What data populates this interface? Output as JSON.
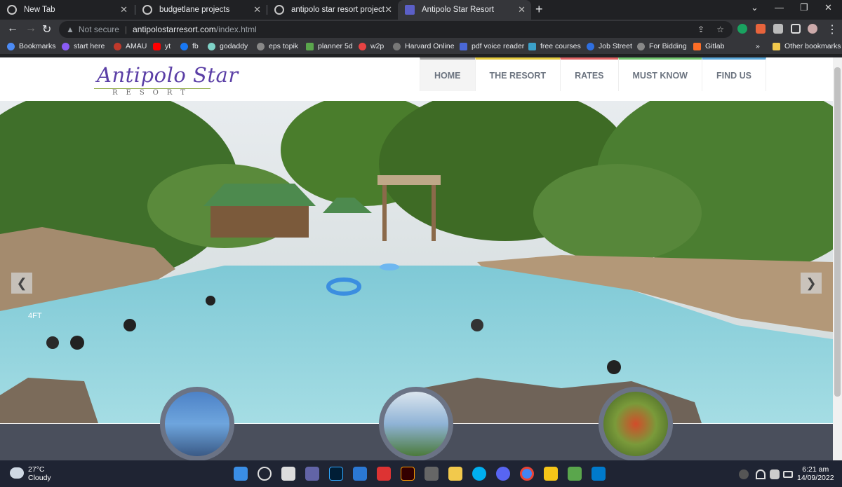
{
  "browser": {
    "tabs": [
      {
        "title": "New Tab"
      },
      {
        "title": "budgetlane projects"
      },
      {
        "title": "antipolo star resort project"
      },
      {
        "title": "Antipolo Star Resort"
      }
    ],
    "url_security": "Not secure",
    "url_host": "antipolostarresort.com",
    "url_path": "/index.html",
    "bookmarks": [
      "Bookmarks",
      "start here",
      "AMAU",
      "yt",
      "fb",
      "godaddy",
      "eps topik",
      "planner 5d",
      "w2p",
      "Harvard Online",
      "pdf voice reader",
      "free courses",
      "Job Street",
      "For Bidding",
      "Gitlab"
    ],
    "other_bookmarks": "Other bookmarks",
    "more_bookmarks": "»"
  },
  "site": {
    "logo_text": "Antipolo Star",
    "logo_sub": "RESORT",
    "menu": [
      {
        "label": "HOME",
        "color": "#9e9e9e"
      },
      {
        "label": "THE RESORT",
        "color": "#e3c93c"
      },
      {
        "label": "RATES",
        "color": "#e06363"
      },
      {
        "label": "MUST KNOW",
        "color": "#6fc36b"
      },
      {
        "label": "FIND US",
        "color": "#5aa7d8"
      }
    ],
    "slider": {
      "prev": "❮",
      "next": "❯"
    },
    "pool_marker": "4FT"
  },
  "taskbar": {
    "temperature": "27°C",
    "condition": "Cloudy",
    "time": "6:21 am",
    "date": "14/09/2022"
  }
}
